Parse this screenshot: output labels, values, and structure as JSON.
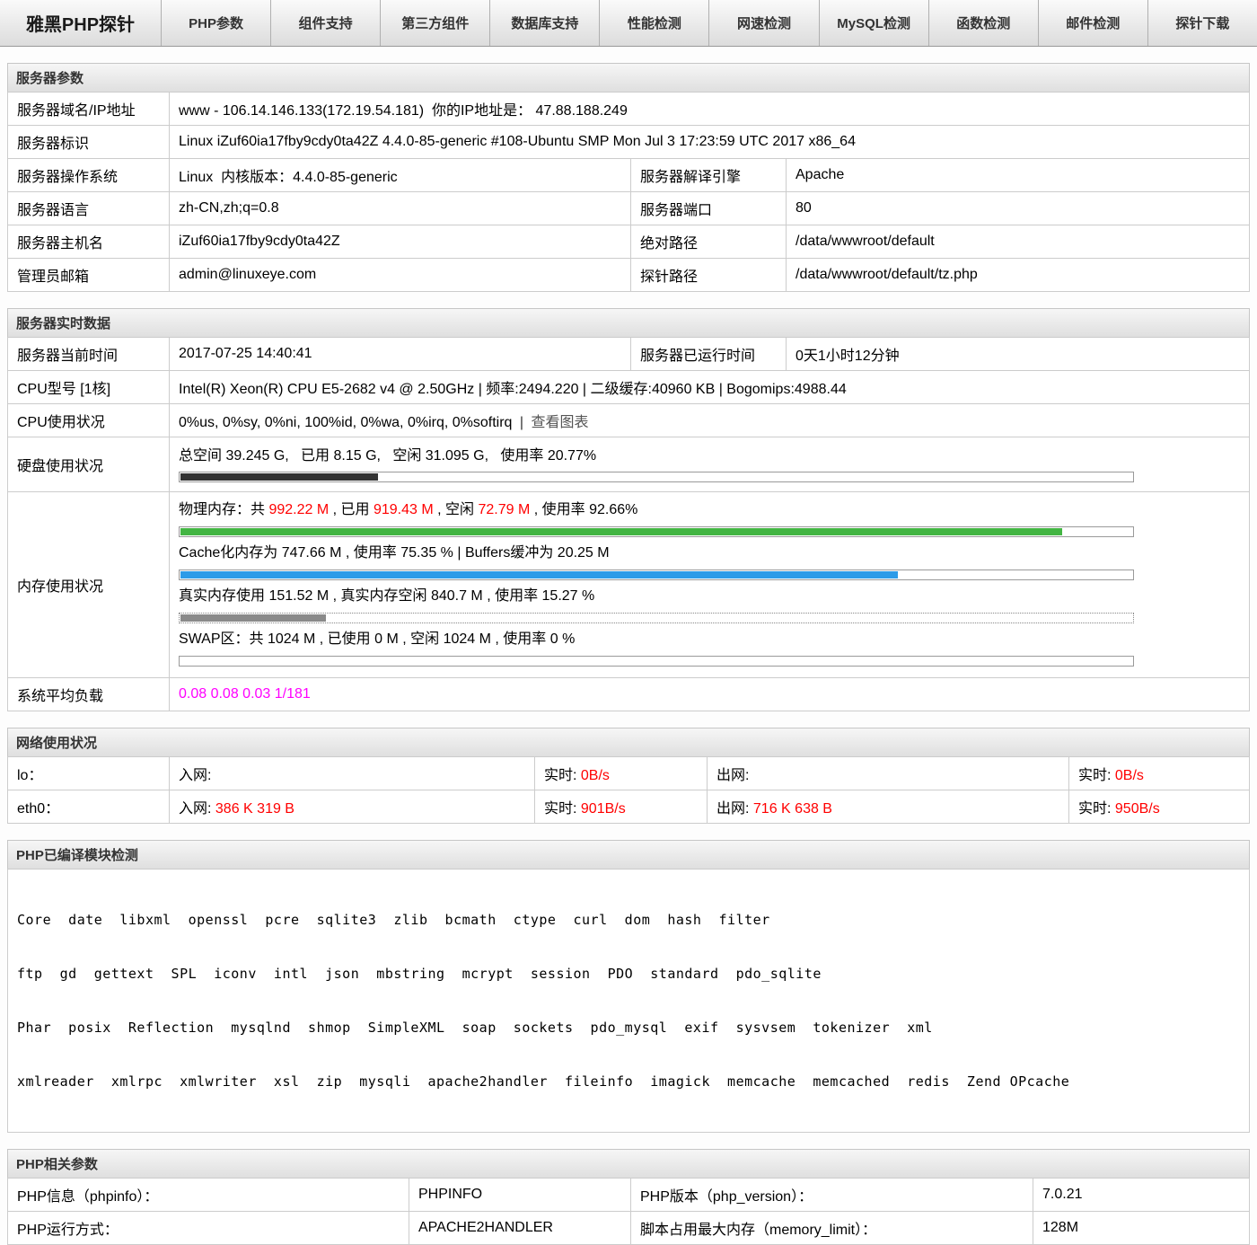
{
  "colors": {
    "accent_red": "#ff0000",
    "load_magenta": "#ff00ff",
    "bar_green": "#43b543",
    "bar_blue": "#2d9be8",
    "bar_dark": "#333333",
    "bar_gray": "#8a8a8a"
  },
  "nav": {
    "brand": "雅黑PHP探针",
    "tabs": [
      "PHP参数",
      "组件支持",
      "第三方组件",
      "数据库支持",
      "性能检测",
      "网速检测",
      "MySQL检测",
      "函数检测",
      "邮件检测",
      "探针下载"
    ]
  },
  "server": {
    "title": "服务器参数",
    "domain": {
      "label": "服务器域名/IP地址",
      "value": "www - 106.14.146.133(172.19.54.181)  你的IP地址是： 47.88.188.249"
    },
    "ident": {
      "label": "服务器标识",
      "value": "Linux iZuf60ia17fby9cdy0ta42Z 4.4.0-85-generic #108-Ubuntu SMP Mon Jul 3 17:23:59 UTC 2017 x86_64"
    },
    "os": {
      "label": "服务器操作系统",
      "value": "Linux  内核版本：4.4.0-85-generic"
    },
    "engine": {
      "label": "服务器解译引擎",
      "value": "Apache"
    },
    "lang": {
      "label": "服务器语言",
      "value": "zh-CN,zh;q=0.8"
    },
    "port": {
      "label": "服务器端口",
      "value": "80"
    },
    "hostname": {
      "label": "服务器主机名",
      "value": "iZuf60ia17fby9cdy0ta42Z"
    },
    "abspath": {
      "label": "绝对路径",
      "value": "/data/wwwroot/default"
    },
    "admin_mail": {
      "label": "管理员邮箱",
      "value": "admin@linuxeye.com"
    },
    "probe_path": {
      "label": "探针路径",
      "value": "/data/wwwroot/default/tz.php"
    }
  },
  "realtime": {
    "title": "服务器实时数据",
    "now": {
      "label": "服务器当前时间",
      "value": "2017-07-25 14:40:41"
    },
    "uptime": {
      "label": "服务器已运行时间",
      "value": "0天1小时12分钟"
    },
    "cpu_model": {
      "label": "CPU型号 [1核]",
      "value": "Intel(R) Xeon(R) CPU E5-2682 v4 @ 2.50GHz | 频率:2494.220 | 二级缓存:40960 KB | Bogomips:4988.44"
    },
    "cpu_usage": {
      "label": "CPU使用状况",
      "value": "0%us, 0%sy, 0%ni, 100%id, 0%wa, 0%irq, 0%softirq",
      "sep": "|",
      "chart_link": "查看图表"
    },
    "disk": {
      "label": "硬盘使用状况",
      "text": "总空间 39.245 G,   已用 8.15 G,   空闲 31.095 G,   使用率 20.77%"
    },
    "memory": {
      "label": "内存使用状况",
      "physical": [
        "物理内存：共 ",
        "992.22 M",
        " , 已用 ",
        "919.43 M",
        " , 空闲 ",
        "72.79 M",
        " , 使用率 92.66%"
      ],
      "cache_text": "Cache化内存为 747.66 M , 使用率 75.35 % | Buffers缓冲为 20.25 M",
      "real_text": "真实内存使用 151.52 M , 真实内存空闲 840.7 M , 使用率 15.27 %",
      "swap_text": "SWAP区：共 1024 M , 已使用 0 M , 空闲 1024 M , 使用率 0 %"
    },
    "load": {
      "label": "系统平均负载",
      "value": "0.08 0.08 0.03 1/181"
    }
  },
  "bars": {
    "disk_percent": 20.77,
    "mem_percent": 92.66,
    "cache_percent": 75.35,
    "real_percent": 15.27,
    "swap_percent": 0
  },
  "network": {
    "title": "网络使用状况",
    "rows": [
      {
        "iface": "lo：",
        "in_label": "入网:",
        "in_value": "",
        "in_rt_label": "实时:",
        "in_rt_value": "0B/s",
        "out_label": "出网:",
        "out_value": "",
        "out_rt_label": "实时:",
        "out_rt_value": "0B/s"
      },
      {
        "iface": "eth0：",
        "in_label": "入网:",
        "in_value": "386 K 319 B",
        "in_rt_label": "实时:",
        "in_rt_value": "901B/s",
        "out_label": "出网:",
        "out_value": "716 K 638 B",
        "out_rt_label": "实时:",
        "out_rt_value": "950B/s"
      }
    ]
  },
  "modules": {
    "title": "PHP已编译模块检测",
    "lines": [
      "Core  date  libxml  openssl  pcre  sqlite3  zlib  bcmath  ctype  curl  dom  hash  filter",
      "ftp  gd  gettext  SPL  iconv  intl  json  mbstring  mcrypt  session  PDO  standard  pdo_sqlite",
      "Phar  posix  Reflection  mysqlnd  shmop  SimpleXML  soap  sockets  pdo_mysql  exif  sysvsem  tokenizer  xml",
      "xmlreader  xmlrpc  xmlwriter  xsl  zip  mysqli  apache2handler  fileinfo  imagick  memcache  memcached  redis  Zend OPcache"
    ]
  },
  "php": {
    "title": "PHP相关参数",
    "phpinfo": {
      "label": "PHP信息（phpinfo）：",
      "value": "PHPINFO"
    },
    "version": {
      "label": "PHP版本（php_version）：",
      "value": "7.0.21"
    },
    "sapi": {
      "label": "PHP运行方式：",
      "value": "APACHE2HANDLER"
    },
    "memory_limit": {
      "label": "脚本占用最大内存（memory_limit）：",
      "value": "128M"
    }
  }
}
